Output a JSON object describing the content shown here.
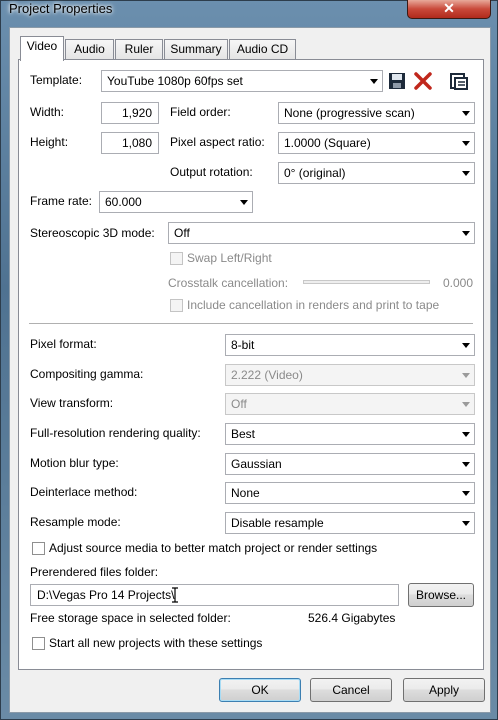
{
  "window": {
    "title": "Project Properties",
    "close_label": "✕"
  },
  "tabs": [
    {
      "label": "Video",
      "active": true
    },
    {
      "label": "Audio",
      "active": false
    },
    {
      "label": "Ruler",
      "active": false
    },
    {
      "label": "Summary",
      "active": false
    },
    {
      "label": "Audio CD",
      "active": false
    }
  ],
  "template": {
    "label": "Template:",
    "value": "YouTube 1080p 60fps set",
    "icons": [
      "save-icon",
      "delete-icon",
      "template-info-icon"
    ]
  },
  "width": {
    "label": "Width:",
    "value": "1,920"
  },
  "height": {
    "label": "Height:",
    "value": "1,080"
  },
  "field_order": {
    "label": "Field order:",
    "value": "None (progressive scan)"
  },
  "pixel_aspect": {
    "label": "Pixel aspect ratio:",
    "value": "1.0000 (Square)"
  },
  "output_rotation": {
    "label": "Output rotation:",
    "value": "0° (original)"
  },
  "frame_rate": {
    "label": "Frame rate:",
    "value": "60.000"
  },
  "stereo": {
    "label": "Stereoscopic 3D mode:",
    "value": "Off",
    "swap_label": "Swap Left/Right",
    "crosstalk_label": "Crosstalk cancellation:",
    "crosstalk_value": "0.000",
    "include_label": "Include cancellation in renders and print to tape"
  },
  "pixel_format": {
    "label": "Pixel format:",
    "value": "8-bit"
  },
  "compositing_gamma": {
    "label": "Compositing gamma:",
    "value": "2.222 (Video)"
  },
  "view_transform": {
    "label": "View transform:",
    "value": "Off"
  },
  "render_quality": {
    "label": "Full-resolution rendering quality:",
    "value": "Best"
  },
  "motion_blur": {
    "label": "Motion blur type:",
    "value": "Gaussian"
  },
  "deinterlace": {
    "label": "Deinterlace method:",
    "value": "None"
  },
  "resample": {
    "label": "Resample mode:",
    "value": "Disable resample"
  },
  "adjust_media": {
    "label": "Adjust source media to better match project or render settings",
    "checked": false
  },
  "prerendered": {
    "label": "Prerendered files folder:",
    "value": "D:\\Vegas Pro 14 Projects\\",
    "browse_label": "Browse...",
    "free_label": "Free storage space in selected folder:",
    "free_value": "526.4 Gigabytes"
  },
  "start_all": {
    "label": "Start all new projects with these settings",
    "checked": false
  },
  "buttons": {
    "ok": "OK",
    "cancel": "Cancel",
    "apply": "Apply"
  },
  "colors": {
    "window_frame": "#5a7a95",
    "close_red": "#c9493a",
    "delete_red": "#c0271c",
    "dialog_bg": "#f0f0f0"
  }
}
